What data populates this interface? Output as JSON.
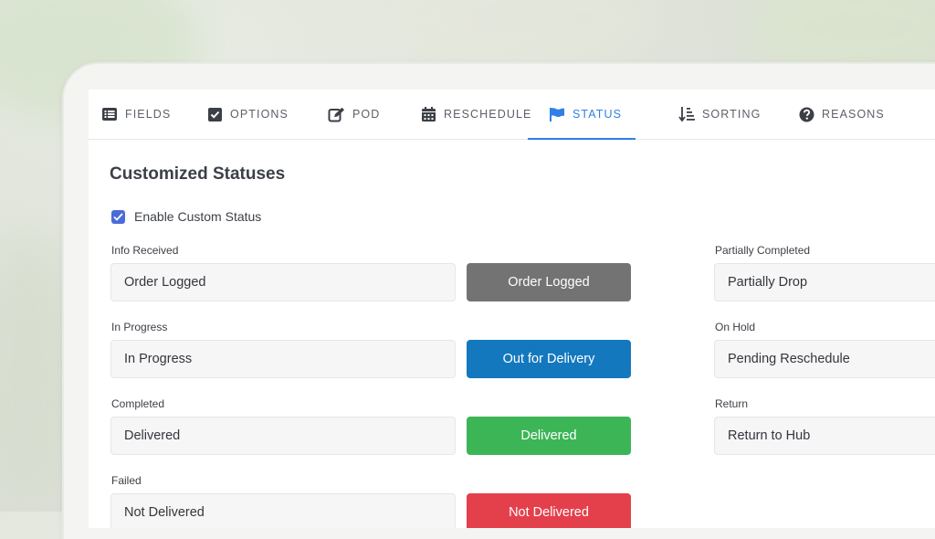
{
  "tabs": [
    {
      "label": "FIELDS",
      "icon": "list-icon"
    },
    {
      "label": "OPTIONS",
      "icon": "checkbox-icon"
    },
    {
      "label": "POD",
      "icon": "edit-icon"
    },
    {
      "label": "RESCHEDULE",
      "icon": "calendar-icon"
    },
    {
      "label": "STATUS",
      "icon": "flag-icon",
      "active": true
    },
    {
      "label": "SORTING",
      "icon": "sort-icon"
    },
    {
      "label": "REASONS",
      "icon": "question-icon"
    }
  ],
  "page": {
    "title": "Customized Statuses",
    "enable_label": "Enable Custom Status",
    "enable_checked": true
  },
  "statuses": [
    {
      "label": "Info Received",
      "value": "Order Logged",
      "badge": "Order Logged",
      "color": "#737373"
    },
    {
      "label": "In Progress",
      "value": "In Progress",
      "badge": "Out for Delivery",
      "color": "#1478be"
    },
    {
      "label": "Completed",
      "value": "Delivered",
      "badge": "Delivered",
      "color": "#3cb556"
    },
    {
      "label": "Failed",
      "value": "Not Delivered",
      "badge": "Not Delivered",
      "color": "#e4404c"
    }
  ],
  "right_statuses": [
    {
      "label": "Partially Completed",
      "value": "Partially Drop"
    },
    {
      "label": "On Hold",
      "value": "Pending Reschedule"
    },
    {
      "label": "Return",
      "value": "Return to Hub"
    }
  ],
  "colors": {
    "accent": "#2f7fe6",
    "checkbox": "#4a6cd9"
  }
}
